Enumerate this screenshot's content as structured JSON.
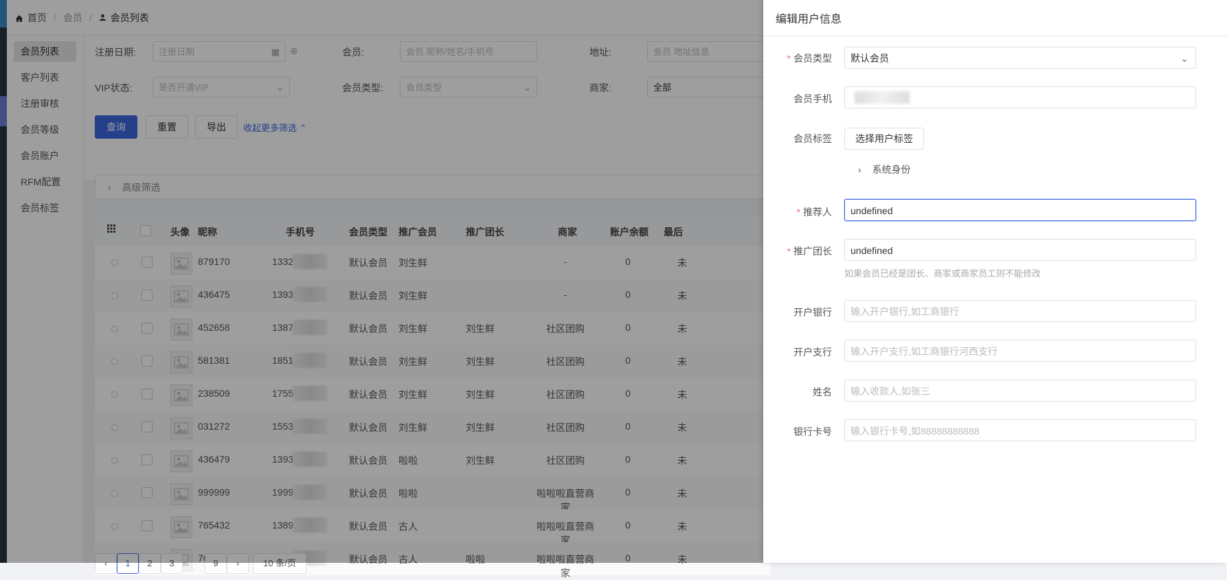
{
  "breadcrumb": {
    "home": "首页",
    "section": "会员",
    "current": "会员列表"
  },
  "subnav": {
    "items": [
      "会员列表",
      "客户列表",
      "注册审核",
      "会员等级",
      "会员账户",
      "RFM配置",
      "会员标签"
    ]
  },
  "filters": {
    "reg_date_label": "注册日期:",
    "reg_date_placeholder": "注册日期",
    "member_label": "会员:",
    "member_placeholder": "会员 昵称/姓名/手机号",
    "address_label": "地址:",
    "address_placeholder": "会员 地址信息",
    "vip_label": "VIP状态:",
    "vip_placeholder": "是否开通VIP",
    "member_type_label": "会员类型:",
    "member_type_placeholder": "会员类型",
    "merchant_label": "商家:",
    "merchant_value": "全部",
    "query_btn": "查询",
    "reset_btn": "重置",
    "export_btn": "导出",
    "collapse_link": "收起更多筛选",
    "advanced_filter": "高级筛选"
  },
  "table": {
    "headers": [
      "头像",
      "昵称",
      "手机号",
      "会员类型",
      "推广会员",
      "推广团长",
      "商家",
      "账户余额",
      "最后"
    ],
    "rows": [
      {
        "nick": "879170",
        "phone": "13320",
        "type": "默认会员",
        "promoter": "刘生鲜",
        "leader": "",
        "merchant": "-",
        "balance": "0",
        "last": "未"
      },
      {
        "nick": "436475",
        "phone": "13939",
        "type": "默认会员",
        "promoter": "刘生鲜",
        "leader": "",
        "merchant": "-",
        "balance": "0",
        "last": "未"
      },
      {
        "nick": "452658",
        "phone": "13871",
        "type": "默认会员",
        "promoter": "刘生鲜",
        "leader": "刘生鲜",
        "merchant": "社区团购",
        "balance": "0",
        "last": "未"
      },
      {
        "nick": "581381",
        "phone": "18519",
        "type": "默认会员",
        "promoter": "刘生鲜",
        "leader": "刘生鲜",
        "merchant": "社区团购",
        "balance": "0",
        "last": "未"
      },
      {
        "nick": "238509",
        "phone": "1755",
        "type": "默认会员",
        "promoter": "刘生鲜",
        "leader": "刘生鲜",
        "merchant": "社区团购",
        "balance": "0",
        "last": "未"
      },
      {
        "nick": "031272",
        "phone": "15530",
        "type": "默认会员",
        "promoter": "刘生鲜",
        "leader": "刘生鲜",
        "merchant": "社区团购",
        "balance": "0",
        "last": "未"
      },
      {
        "nick": "436479",
        "phone": "13939",
        "type": "默认会员",
        "promoter": "啦啦",
        "leader": "刘生鲜",
        "merchant": "社区团购",
        "balance": "0",
        "last": "未"
      },
      {
        "nick": "999999",
        "phone": "19999",
        "type": "默认会员",
        "promoter": "啦啦",
        "leader": "",
        "merchant": "啦啦啦直营商家",
        "balance": "0",
        "last": "未"
      },
      {
        "nick": "765432",
        "phone": "13898",
        "type": "默认会员",
        "promoter": "古人",
        "leader": "",
        "merchant": "啦啦啦直营商家",
        "balance": "0",
        "last": "未"
      },
      {
        "nick": "769876",
        "phone": "13298",
        "type": "默认会员",
        "promoter": "古人",
        "leader": "啦啦",
        "merchant": "啦啦啦直营商家",
        "balance": "0",
        "last": "未"
      }
    ]
  },
  "pager": {
    "pages": [
      "1",
      "2",
      "3"
    ],
    "last_page": "9",
    "page_size": "10 条/页"
  },
  "drawer": {
    "title": "编辑用户信息",
    "member_type_label": "会员类型",
    "member_type_value": "默认会员",
    "phone_label": "会员手机",
    "tags_label": "会员标签",
    "tags_button": "选择用户标签",
    "system_role": "系统身份",
    "referrer_label": "推荐人",
    "referrer_value": "undefined",
    "leader_label": "推广团长",
    "leader_value": "undefined",
    "leader_hint": "如果会员已经是团长、商家或商家员工则不能修改",
    "bank_label": "开户银行",
    "bank_placeholder": "输入开户银行,如工商银行",
    "branch_label": "开户支行",
    "branch_placeholder": "输入开户支行,如工商银行河西支行",
    "name_label": "姓名",
    "name_placeholder": "输入收款人,如张三",
    "card_label": "银行卡号",
    "card_placeholder": "输入银行卡号,如88888888888"
  }
}
